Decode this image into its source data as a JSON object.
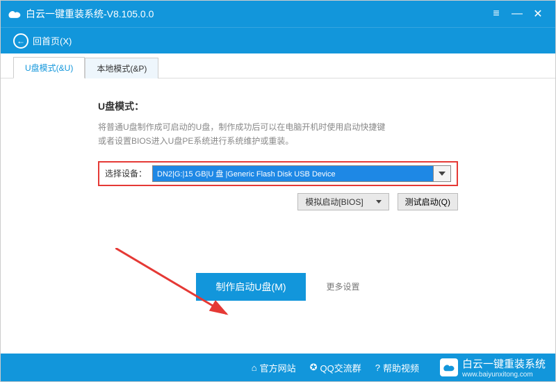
{
  "titlebar": {
    "title": "白云一键重装系统-V8.105.0.0"
  },
  "back": {
    "label": "回首页(X)"
  },
  "tabs": {
    "u": "U盘模式(&U)",
    "local": "本地模式(&P)"
  },
  "panel": {
    "heading": "U盘模式：",
    "desc1": "将普通U盘制作成可启动的U盘，制作成功后可以在电脑开机时使用启动快捷键",
    "desc2": "或者设置BIOS进入U盘PE系统进行系统维护或重装。",
    "selectLabel": "选择设备：",
    "selectedDevice": "DN2|G:|15 GB|U 盘 |Generic Flash Disk USB Device",
    "simBoot": "模拟启动[BIOS]",
    "testBoot": "测试启动(Q)",
    "makeBtn": "制作启动U盘(M)",
    "more": "更多设置"
  },
  "footer": {
    "site": "官方网站",
    "qq": "QQ交流群",
    "help": "帮助视频",
    "brand": "白云一键重装系统",
    "url": "www.baiyunxitong.com"
  }
}
